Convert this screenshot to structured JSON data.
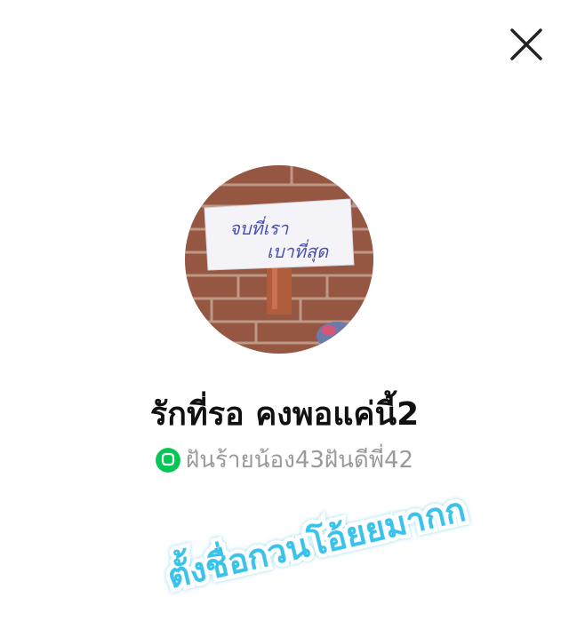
{
  "profile": {
    "name": "รักที่รอ คงพอแค่นี้2",
    "status_message": "ฝันร้ายน้อง43ฝันดีพี่42",
    "avatar_sign_text_line1": "จบที่เรา",
    "avatar_sign_text_line2": "เบาที่สุด"
  },
  "sticker": {
    "text": "ตั้งชื่อกวนโอ้ยยมากก"
  },
  "icons": {
    "close": "close-icon",
    "status": "line-chat-icon"
  },
  "colors": {
    "status_icon": "#06c755",
    "sticker_fill": "#3ac3ea",
    "sticker_outline": "#ffffff",
    "status_text": "#9a9a9a"
  }
}
